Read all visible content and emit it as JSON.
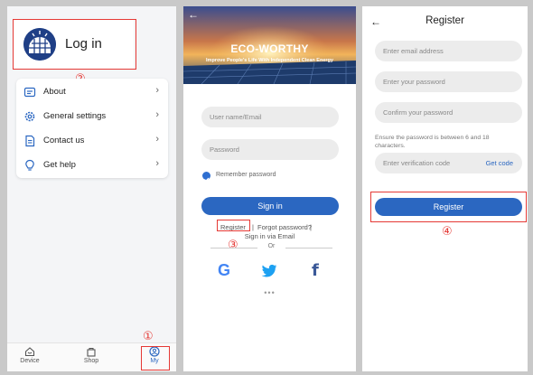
{
  "left_screen": {
    "login_label": "Log in",
    "marker": "②",
    "menu": [
      {
        "label": "About",
        "icon": "info-icon"
      },
      {
        "label": "General settings",
        "icon": "gear-icon"
      },
      {
        "label": "Contact us",
        "icon": "document-icon"
      },
      {
        "label": "Get help",
        "icon": "lightbulb-icon"
      }
    ],
    "chevron": "›",
    "tabs": [
      {
        "label": "Device",
        "icon": "home-icon"
      },
      {
        "label": "Shop",
        "icon": "shopping-bag-icon"
      },
      {
        "label": "My",
        "icon": "user-icon"
      }
    ],
    "tab_marker": "①",
    "active_color": "#2b67c1"
  },
  "middle_screen": {
    "back": "←",
    "brand": "ECO-WORTHY",
    "slogan": "Improve People's Life With Independent Clean Energy",
    "username_placeholder": "User name/Email",
    "password_placeholder": "Password",
    "remember_label": "Remember password",
    "sign_in_label": "Sign in",
    "register_link": "Register",
    "separator": "|",
    "forgot_link": "Forgot password?",
    "via_email": "Sign in via Email",
    "or_text": "Or",
    "marker": "③",
    "social": [
      "G",
      "twitter-icon",
      "f"
    ],
    "more": "•••",
    "accent": "#2b67c1"
  },
  "right_screen": {
    "back": "←",
    "title": "Register",
    "email_placeholder": "Enter email address",
    "password_placeholder": "Enter your password",
    "confirm_placeholder": "Confirm your password",
    "hint": "Ensure the password is between 6 and 18 characters.",
    "code_placeholder": "Enter verification code",
    "get_code": "Get code",
    "register_button": "Register",
    "marker": "④"
  }
}
